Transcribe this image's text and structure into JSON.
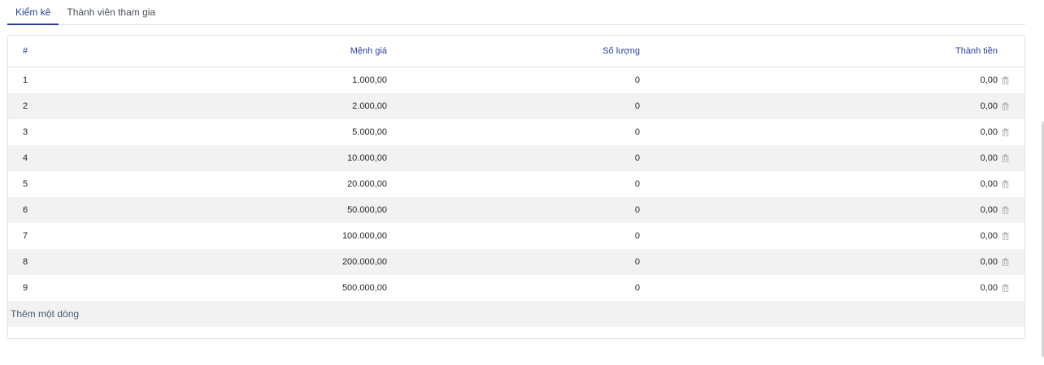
{
  "tabs": [
    {
      "label": "Kiểm kê",
      "active": true
    },
    {
      "label": "Thành viên tham gia",
      "active": false
    }
  ],
  "table": {
    "headers": {
      "index": "#",
      "denomination": "Mệnh giá",
      "quantity": "Số lượng",
      "total": "Thành tiền"
    },
    "rows": [
      {
        "index": "1",
        "denomination": "1.000,00",
        "quantity": "0",
        "total": "0,00"
      },
      {
        "index": "2",
        "denomination": "2.000,00",
        "quantity": "0",
        "total": "0,00"
      },
      {
        "index": "3",
        "denomination": "5.000,00",
        "quantity": "0",
        "total": "0,00"
      },
      {
        "index": "4",
        "denomination": "10.000,00",
        "quantity": "0",
        "total": "0,00"
      },
      {
        "index": "5",
        "denomination": "20.000,00",
        "quantity": "0",
        "total": "0,00"
      },
      {
        "index": "6",
        "denomination": "50.000,00",
        "quantity": "0",
        "total": "0,00"
      },
      {
        "index": "7",
        "denomination": "100.000,00",
        "quantity": "0",
        "total": "0,00"
      },
      {
        "index": "8",
        "denomination": "200.000,00",
        "quantity": "0",
        "total": "0,00"
      },
      {
        "index": "9",
        "denomination": "500.000,00",
        "quantity": "0",
        "total": "0,00"
      }
    ],
    "add_row_label": "Thêm một dòng",
    "row_action_icon": "trash-icon"
  },
  "colors": {
    "accent": "#2a3f9a",
    "stripe": "#f2f2f2",
    "border": "#dee2e6"
  }
}
